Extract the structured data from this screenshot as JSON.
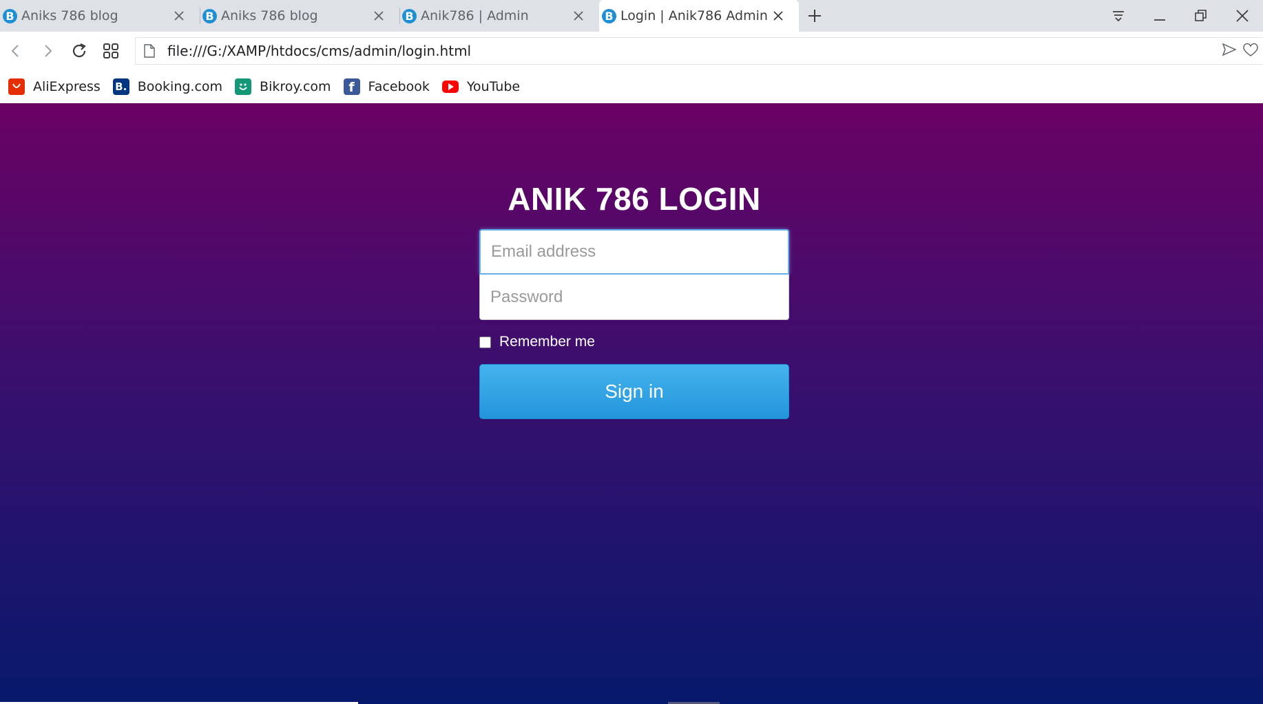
{
  "tabs": [
    {
      "title": "Aniks 786 blog",
      "favicon": "B",
      "active": false
    },
    {
      "title": "Aniks 786 blog",
      "favicon": "B",
      "active": false
    },
    {
      "title": "Anik786 | Admin",
      "favicon": "B",
      "active": false
    },
    {
      "title": "Login | Anik786 Admin",
      "favicon": "B",
      "active": true
    }
  ],
  "address_bar": {
    "url": "file:///G:/XAMP/htdocs/cms/admin/login.html"
  },
  "bookmarks": [
    {
      "label": "AliExpress",
      "icon": "aliexpress-icon",
      "color": "#e62e04"
    },
    {
      "label": "Booking.com",
      "icon": "booking-icon",
      "color": "#003580",
      "glyph": "B."
    },
    {
      "label": "Bikroy.com",
      "icon": "bikroy-icon",
      "color": "#149777"
    },
    {
      "label": "Facebook",
      "icon": "facebook-icon",
      "color": "#3b5998",
      "glyph": "f"
    },
    {
      "label": "YouTube",
      "icon": "youtube-icon",
      "color": "#ff0000"
    }
  ],
  "login": {
    "title": "ANIK 786 LOGIN",
    "email_placeholder": "Email address",
    "password_placeholder": "Password",
    "remember_label": "Remember me",
    "signin_label": "Sign in"
  },
  "colors": {
    "gradient_top": "#6a0264",
    "gradient_bottom": "#07196c",
    "button": "#2a9de0"
  }
}
